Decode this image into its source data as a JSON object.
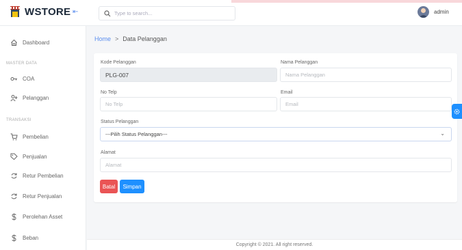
{
  "brand": {
    "name": "WSTORE"
  },
  "search": {
    "placeholder": "Type to search..."
  },
  "user": {
    "name": "admin"
  },
  "sidebar": {
    "items": [
      {
        "label": "Dashboard",
        "icon": "home-icon"
      },
      {
        "label": "COA",
        "icon": "key-icon"
      },
      {
        "label": "Pelanggan",
        "icon": "user-plus-icon"
      },
      {
        "label": "Pembelian",
        "icon": "cart-icon"
      },
      {
        "label": "Penjualan",
        "icon": "tag-icon"
      },
      {
        "label": "Retur Pembelian",
        "icon": "refresh-icon"
      },
      {
        "label": "Retur Penjualan",
        "icon": "refresh-icon"
      },
      {
        "label": "Perolehan Asset",
        "icon": "dollar-icon"
      },
      {
        "label": "Beban",
        "icon": "dollar-icon"
      }
    ],
    "sections": {
      "master": "MASTER DATA",
      "transaksi": "TRANSAKSI"
    }
  },
  "breadcrumb": {
    "home": "Home",
    "current": "Data Pelanggan"
  },
  "form": {
    "kode": {
      "label": "Kode Pelanggan",
      "value": "PLG-007"
    },
    "nama": {
      "label": "Nama Pelanggan",
      "placeholder": "Nama Pelanggan"
    },
    "telp": {
      "label": "No Telp",
      "placeholder": "No Telp"
    },
    "email": {
      "label": "Email",
      "placeholder": "Email"
    },
    "status": {
      "label": "Status Pelanggan",
      "value": "---Pilih Status Pelanggan---"
    },
    "alamat": {
      "label": "Alamat",
      "placeholder": "Alamat"
    },
    "buttons": {
      "cancel": "Batal",
      "save": "Simpan"
    }
  },
  "footer": {
    "text": "Copyright © 2021. All right reserved."
  },
  "colors": {
    "accent": "#1e90ff",
    "danger": "#ea5455",
    "link": "#5a8dee"
  }
}
